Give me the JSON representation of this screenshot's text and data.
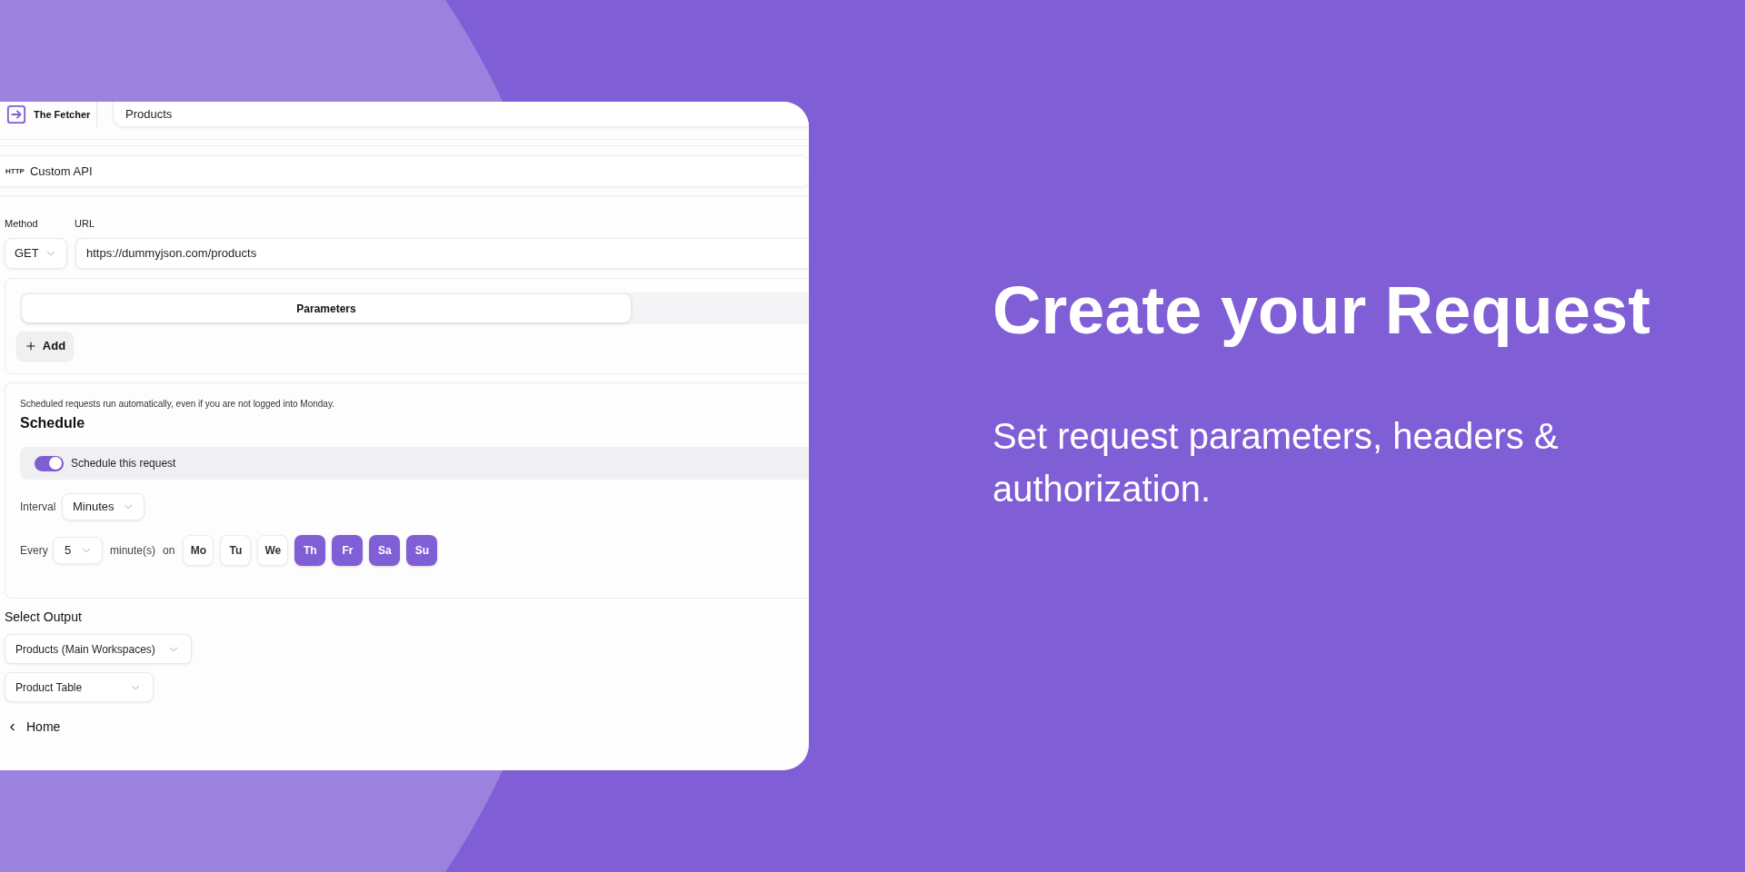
{
  "header": {
    "app_name": "The Fetcher",
    "tab": "Products"
  },
  "source": {
    "badge": "HTTP",
    "label": "Custom API"
  },
  "request": {
    "method_label": "Method",
    "method": "GET",
    "url_label": "URL",
    "url": "https://dummyjson.com/products"
  },
  "param_tabs": [
    {
      "label": "Parameters",
      "selected": true
    }
  ],
  "add_button": "Add",
  "schedule": {
    "note": "Scheduled requests run automatically, even if you are not logged into Monday.",
    "title": "Schedule",
    "toggle": {
      "label": "Schedule this request",
      "on": true
    },
    "interval_label": "Interval",
    "interval": "Minutes",
    "every_label": "Every",
    "every": "5",
    "unit_label": "minute(s)",
    "on_label": "on",
    "days": [
      {
        "label": "Mo",
        "selected": false
      },
      {
        "label": "Tu",
        "selected": false
      },
      {
        "label": "We",
        "selected": false
      },
      {
        "label": "Th",
        "selected": true
      },
      {
        "label": "Fr",
        "selected": true
      },
      {
        "label": "Sa",
        "selected": true
      },
      {
        "label": "Su",
        "selected": true
      }
    ]
  },
  "output": {
    "title": "Select Output",
    "selects": [
      "Products (Main Workspaces)",
      "Product Table"
    ]
  },
  "back_link": "Home",
  "hero": {
    "title": "Create your Request",
    "subtitle": "Set request parameters, headers & authorization."
  }
}
